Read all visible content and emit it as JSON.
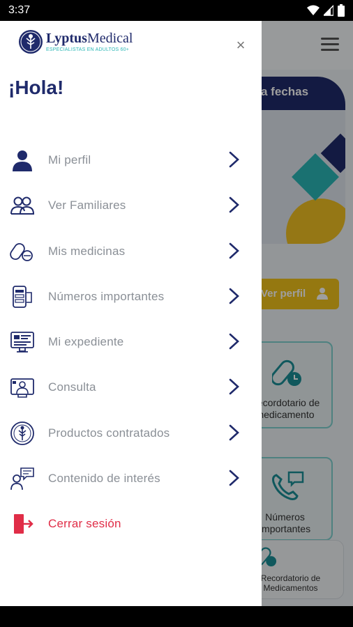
{
  "status_bar": {
    "time": "3:37"
  },
  "app": {
    "banner_text": "a fechas",
    "profile_button": "Ver perfil",
    "card1_label": "Recordotario de medicamento",
    "card1_line1": "Recordotario de",
    "card1_line2": "medicamento",
    "card2_line1": "Números",
    "card2_line2": "importantes",
    "card3_line1": "Recordatorio de",
    "card3_line2": "Medicamentos"
  },
  "drawer": {
    "logo_name_bold": "Lyptus",
    "logo_name_light": "Medical",
    "logo_tagline": "ESPECIALISTAS EN ADULTOS 60+",
    "greeting": "¡Hola!",
    "close_symbol": "×",
    "items": [
      {
        "label": "Mi perfil",
        "icon": "person-icon"
      },
      {
        "label": "Ver Familiares",
        "icon": "family-icon"
      },
      {
        "label": "Mis medicinas",
        "icon": "pills-icon"
      },
      {
        "label": "Números importantes",
        "icon": "phone-list-icon"
      },
      {
        "label": "Mi expediente",
        "icon": "monitor-record-icon"
      },
      {
        "label": "Consulta",
        "icon": "video-consult-icon"
      },
      {
        "label": "Productos contratados",
        "icon": "tree-badge-icon"
      },
      {
        "label": "Contenido de interés",
        "icon": "chat-person-icon"
      }
    ],
    "logout": {
      "label": "Cerrar sesión",
      "icon": "logout-icon"
    }
  },
  "colors": {
    "navy": "#1f2a6b",
    "teal": "#2bb7b6",
    "yellow": "#f1c21b",
    "logout_red": "#e02d47",
    "label_gray": "#8a8f96"
  }
}
